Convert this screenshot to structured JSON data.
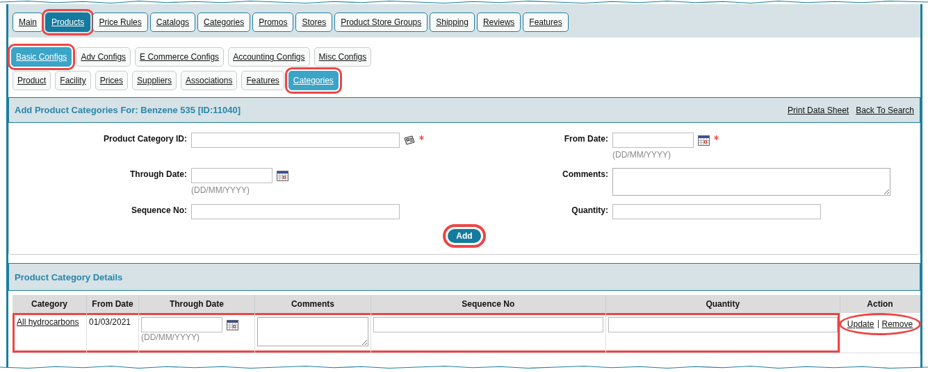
{
  "main_tabs": [
    {
      "label": "Main",
      "selected": false,
      "highlighted": false
    },
    {
      "label": "Products",
      "selected": true,
      "highlighted": true
    },
    {
      "label": "Price Rules",
      "selected": false,
      "highlighted": false
    },
    {
      "label": "Catalogs",
      "selected": false,
      "highlighted": false
    },
    {
      "label": "Categories",
      "selected": false,
      "highlighted": false
    },
    {
      "label": "Promos",
      "selected": false,
      "highlighted": false
    },
    {
      "label": "Stores",
      "selected": false,
      "highlighted": false
    },
    {
      "label": "Product Store Groups",
      "selected": false,
      "highlighted": false
    },
    {
      "label": "Shipping",
      "selected": false,
      "highlighted": false
    },
    {
      "label": "Reviews",
      "selected": false,
      "highlighted": false
    },
    {
      "label": "Features",
      "selected": false,
      "highlighted": false
    }
  ],
  "config_tabs": [
    {
      "label": "Basic Configs",
      "selected": true,
      "highlighted": true
    },
    {
      "label": "Adv Configs",
      "selected": false,
      "highlighted": false
    },
    {
      "label": "E Commerce Configs",
      "selected": false,
      "highlighted": false
    },
    {
      "label": "Accounting Configs",
      "selected": false,
      "highlighted": false
    },
    {
      "label": "Misc Configs",
      "selected": false,
      "highlighted": false
    }
  ],
  "section_tabs": [
    {
      "label": "Product",
      "selected": false,
      "highlighted": false
    },
    {
      "label": "Facility",
      "selected": false,
      "highlighted": false
    },
    {
      "label": "Prices",
      "selected": false,
      "highlighted": false
    },
    {
      "label": "Suppliers",
      "selected": false,
      "highlighted": false
    },
    {
      "label": "Associations",
      "selected": false,
      "highlighted": false
    },
    {
      "label": "Features",
      "selected": false,
      "highlighted": false
    },
    {
      "label": "Categories",
      "selected": true,
      "highlighted": true
    }
  ],
  "add_panel": {
    "title": "Add Product Categories For: Benzene 535 [ID:11040]",
    "links": [
      "Print Data Sheet",
      "Back To Search"
    ],
    "fields": [
      {
        "label": "Product Category ID:",
        "kind": "lookup",
        "required": true
      },
      {
        "label": "From Date:",
        "kind": "date",
        "required": true,
        "hint": "(DD/MM/YYYY)"
      },
      {
        "label": "Through Date:",
        "kind": "date",
        "required": false,
        "hint": "(DD/MM/YYYY)"
      },
      {
        "label": "Comments:",
        "kind": "textarea",
        "required": false
      },
      {
        "label": "Sequence No:",
        "kind": "text",
        "required": false
      },
      {
        "label": "Quantity:",
        "kind": "text",
        "required": false
      }
    ],
    "add_button": {
      "label": "Add",
      "highlighted": true
    }
  },
  "details_panel": {
    "title": "Product Category Details",
    "table": {
      "columns": [
        "Category",
        "From Date",
        "Through Date",
        "Comments",
        "Sequence No",
        "Quantity",
        "Action"
      ],
      "rows": [
        {
          "highlighted": true,
          "category": "All hydrocarbons",
          "from_date": "01/03/2021",
          "through_date_hint": "(DD/MM/YYYY)",
          "actions": [
            "Update",
            "Remove"
          ],
          "actions_highlighted": true
        }
      ]
    }
  }
}
